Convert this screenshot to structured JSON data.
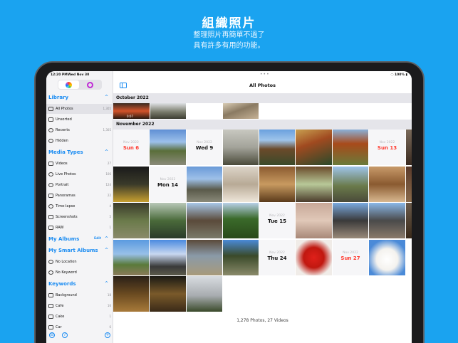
{
  "promo": {
    "headline": "組織照片",
    "line1": "整理照片再簡單不過了",
    "line2": "具有許多有用的功能。"
  },
  "status_bar": {
    "time": "12:20 PM",
    "date": "Wed Nov 30",
    "battery": "100%"
  },
  "sidebar": {
    "sections": [
      {
        "name": "library",
        "title": "Library",
        "expanded": true
      },
      {
        "name": "media-types",
        "title": "Media Types",
        "expanded": true
      },
      {
        "name": "my-albums",
        "title": "My Albums",
        "action": "Edit",
        "expanded": true
      },
      {
        "name": "my-smart-albums",
        "title": "My Smart Albums",
        "expanded": true
      },
      {
        "name": "keywords",
        "title": "Keywords",
        "expanded": true
      }
    ],
    "items": [
      {
        "label": "All Photos",
        "count": "1,305",
        "icon": "photos-icon",
        "selected": true
      },
      {
        "label": "Unsorted",
        "count": "",
        "icon": "tray-icon"
      },
      {
        "label": "Recents",
        "count": "1,305",
        "icon": "clock-icon"
      },
      {
        "label": "Hidden",
        "count": "",
        "icon": "eye-slash-icon"
      },
      {
        "label": "Videos",
        "count": "27",
        "icon": "video-icon"
      },
      {
        "label": "Live Photos",
        "count": "106",
        "icon": "live-photo-icon"
      },
      {
        "label": "Portrait",
        "count": "124",
        "icon": "portrait-icon"
      },
      {
        "label": "Panoramas",
        "count": "22",
        "icon": "panorama-icon"
      },
      {
        "label": "Time-lapse",
        "count": "4",
        "icon": "timelapse-icon"
      },
      {
        "label": "Screenshots",
        "count": "5",
        "icon": "screenshot-icon"
      },
      {
        "label": "RAW",
        "count": "1",
        "icon": "raw-icon"
      },
      {
        "label": "No Location",
        "count": "",
        "icon": "location-slash-icon"
      },
      {
        "label": "No Keyword",
        "count": "",
        "icon": "tag-slash-icon"
      },
      {
        "label": "Background",
        "count": "18",
        "icon": "tag-icon"
      },
      {
        "label": "Cafe",
        "count": "16",
        "icon": "tag-icon"
      },
      {
        "label": "Cake",
        "count": "1",
        "icon": "tag-icon"
      },
      {
        "label": "Car",
        "count": "6",
        "icon": "tag-icon"
      }
    ]
  },
  "main": {
    "title": "All Photos",
    "groups": [
      {
        "label": "October 2022"
      },
      {
        "label": "November 2022"
      }
    ],
    "date_cells": [
      {
        "small": "Nov 2022",
        "big": "Sun 6",
        "red": true
      },
      {
        "small": "Nov 2022",
        "big": "Wed 9",
        "red": false
      },
      {
        "small": "Nov 2022",
        "big": "Sun 13",
        "red": true
      },
      {
        "small": "Nov 2022",
        "big": "Mon 14",
        "red": false
      },
      {
        "small": "Nov 2022",
        "big": "Tue 15",
        "red": false
      },
      {
        "small": "Nov 2022",
        "big": "Thu 24",
        "red": false
      },
      {
        "small": "Nov 2022",
        "big": "Sun 27",
        "red": true
      }
    ],
    "video_duration": "0:07",
    "footer": "1,278 Photos, 27 Videos"
  }
}
